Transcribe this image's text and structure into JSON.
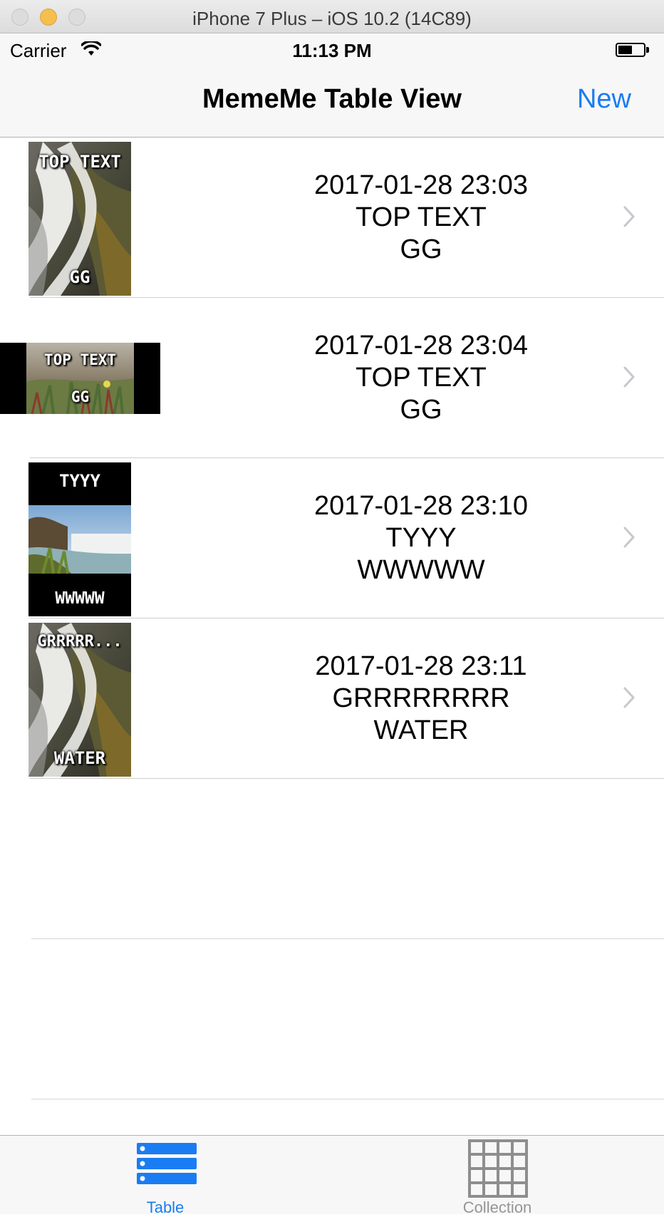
{
  "window": {
    "title": "iPhone 7 Plus – iOS 10.2 (14C89)"
  },
  "status_bar": {
    "carrier": "Carrier",
    "time": "11:13 PM",
    "battery_level": 0.55
  },
  "nav": {
    "title": "MemeMe Table View",
    "new_label": "New"
  },
  "memes": [
    {
      "date": "2017-01-28 23:03",
      "top": "TOP TEXT",
      "bottom": "GG",
      "thumb_top": "TOP TEXT",
      "thumb_bottom": "GG"
    },
    {
      "date": "2017-01-28 23:04",
      "top": "TOP TEXT",
      "bottom": "GG",
      "thumb_top": "TOP TEXT",
      "thumb_bottom": "GG"
    },
    {
      "date": "2017-01-28 23:10",
      "top": "TYYY",
      "bottom": "WWWWW",
      "thumb_top": "TYYY",
      "thumb_bottom": "WWWWW"
    },
    {
      "date": "2017-01-28 23:11",
      "top": "GRRRRRRRR",
      "bottom": "WATER",
      "thumb_top": "GRRRRR...",
      "thumb_bottom": "WATER"
    }
  ],
  "tabs": {
    "table_label": "Table",
    "collection_label": "Collection"
  },
  "colors": {
    "accent": "#1a7cf2",
    "inactive": "#959595"
  }
}
